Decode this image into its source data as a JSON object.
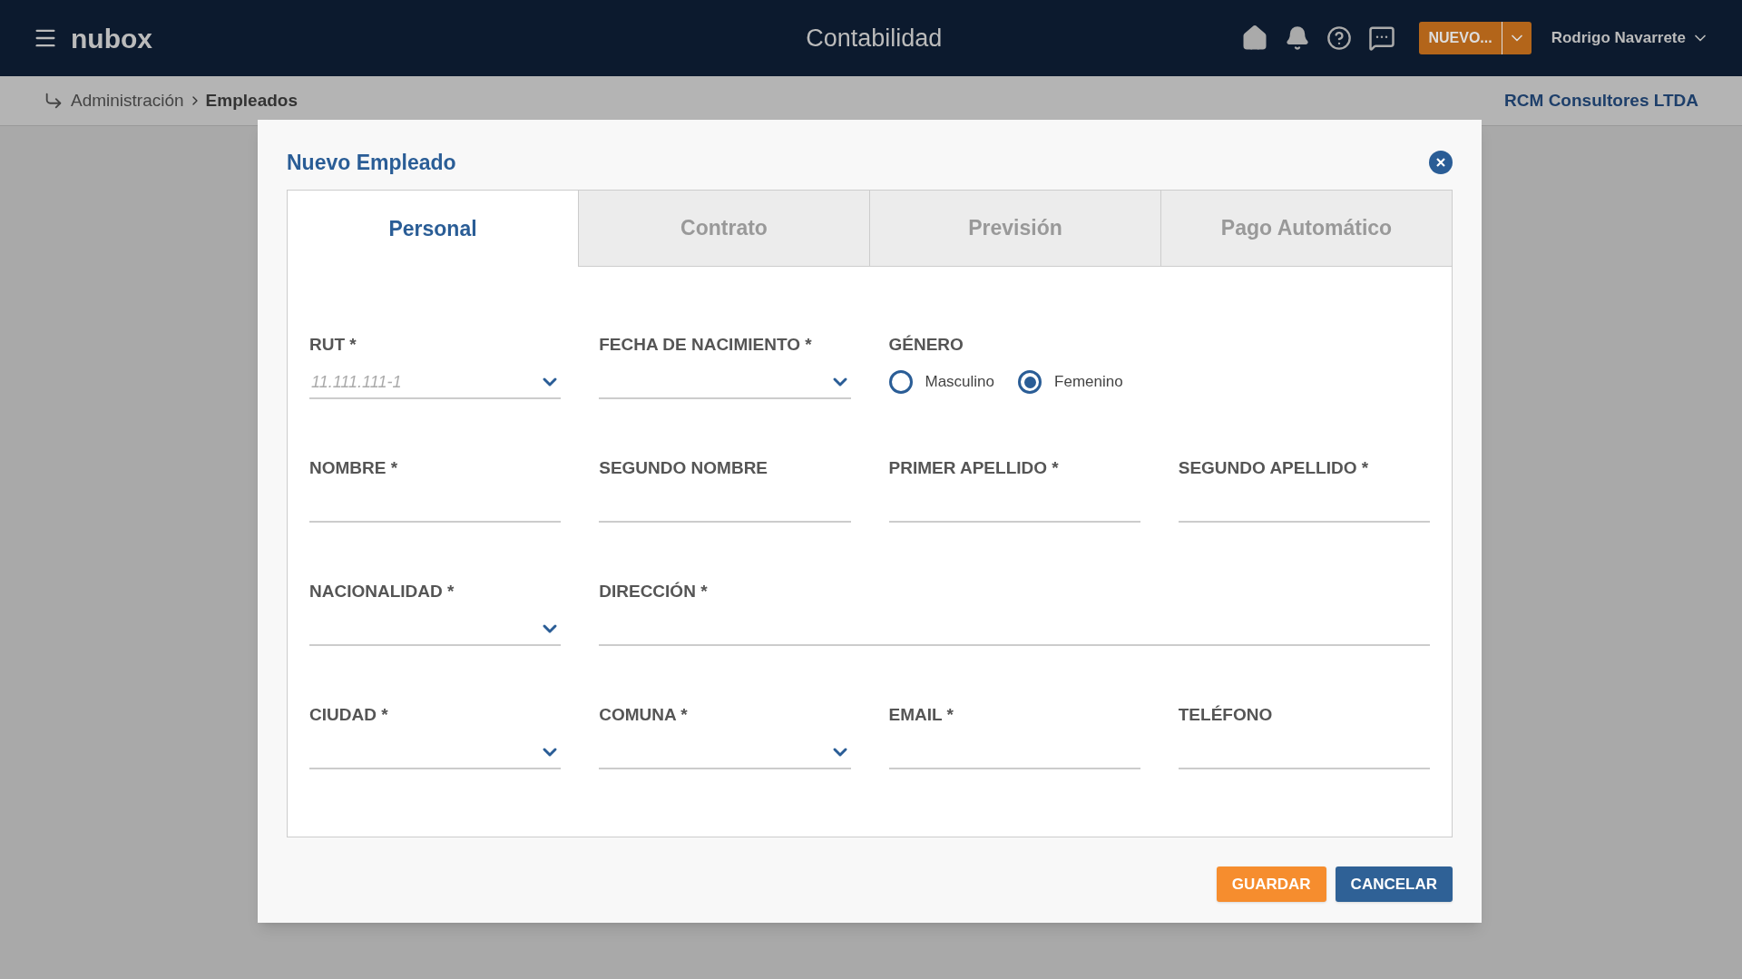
{
  "header": {
    "logo": "nubox",
    "title": "Contabilidad",
    "new_button": "NUEVO...",
    "user": "Rodrigo Navarrete"
  },
  "breadcrumb": {
    "items": [
      "Administración",
      "Empleados"
    ],
    "company": "RCM Consultores LTDA"
  },
  "modal": {
    "title": "Nuevo Empleado",
    "tabs": [
      {
        "label": "Personal",
        "selected": true
      },
      {
        "label": "Contrato",
        "selected": false
      },
      {
        "label": "Previsión",
        "selected": false
      },
      {
        "label": "Pago Automático",
        "selected": false
      }
    ],
    "rows": [
      [
        {
          "kind": "select",
          "label": "RUT *",
          "placeholder": "11.111.111-1"
        },
        {
          "kind": "select",
          "label": "FECHA DE NACIMIENTO *"
        },
        {
          "kind": "radios",
          "label": "GÉNERO",
          "options": [
            {
              "label": "Masculino",
              "selected": false
            },
            {
              "label": "Femenino",
              "selected": true
            }
          ]
        }
      ],
      [
        {
          "kind": "text",
          "label": "NOMBRE *"
        },
        {
          "kind": "text",
          "label": "SEGUNDO NOMBRE"
        },
        {
          "kind": "text",
          "label": "PRIMER APELLIDO *"
        },
        {
          "kind": "text",
          "label": "SEGUNDO APELLIDO *"
        }
      ],
      [
        {
          "kind": "select",
          "label": "NACIONALIDAD *"
        },
        {
          "kind": "longtext",
          "label": "DIRECCIÓN *"
        }
      ],
      [
        {
          "kind": "select",
          "label": "CIUDAD *"
        },
        {
          "kind": "select",
          "label": "COMUNA *"
        },
        {
          "kind": "text",
          "label": "EMAIL *"
        },
        {
          "kind": "text",
          "label": "TELÉFONO"
        }
      ]
    ],
    "buttons": [
      {
        "kind": "primary",
        "label": "GUARDAR"
      },
      {
        "kind": "secondary",
        "label": "CANCELAR"
      }
    ]
  }
}
